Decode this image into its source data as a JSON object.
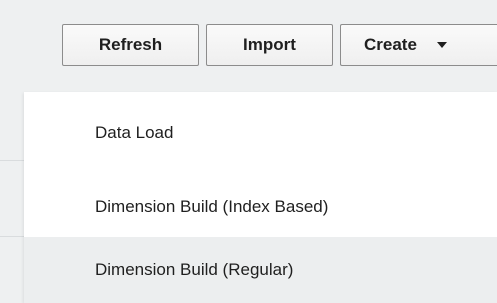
{
  "toolbar": {
    "refresh_label": "Refresh",
    "import_label": "Import",
    "create_label": "Create"
  },
  "create_menu": {
    "items": [
      {
        "label": "Data Load"
      },
      {
        "label": "Dimension Build (Index Based)"
      },
      {
        "label": "Dimension Build (Regular)",
        "hovered": true
      }
    ]
  }
}
